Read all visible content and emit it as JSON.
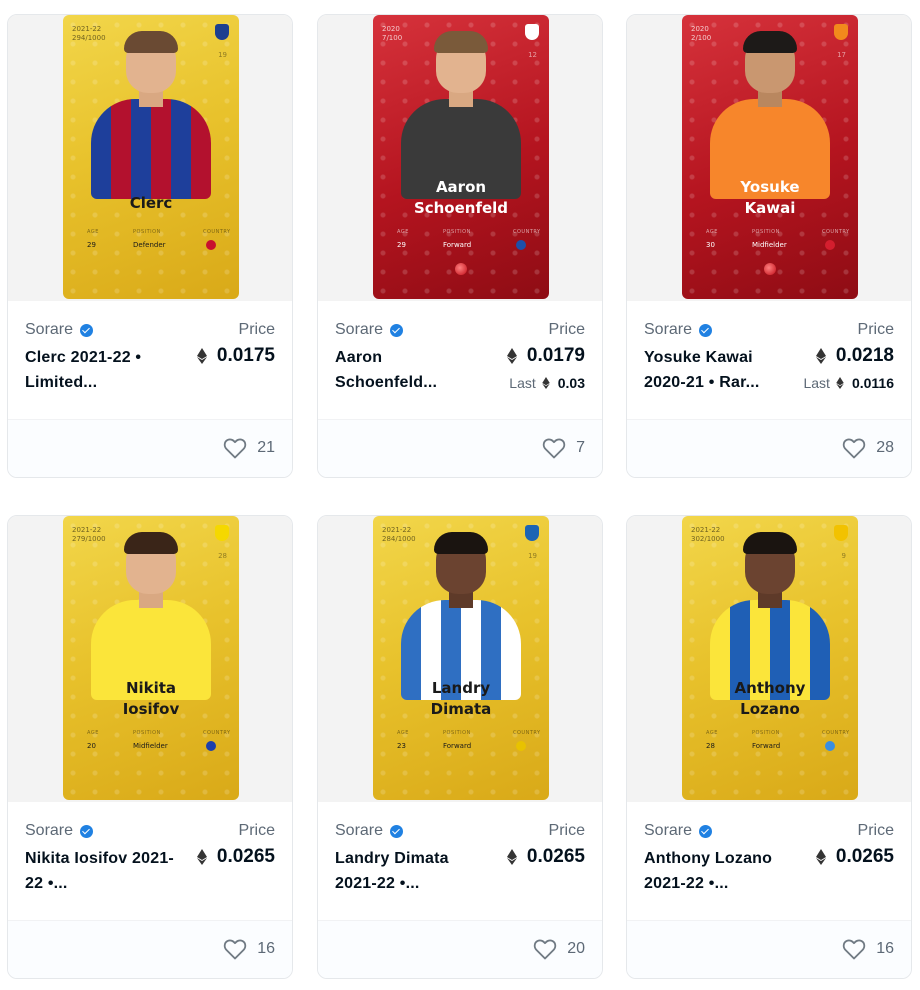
{
  "cards": [
    {
      "card_season": "2021-22",
      "card_serial": "294/1000",
      "card_number": "19",
      "rarity": "limited",
      "card_name": "Clerc",
      "age": "29",
      "position": "Defender",
      "flag_color": "#c8102e",
      "crest_color": "#1d3f8f",
      "kit_primary": "#1e3f9b",
      "kit_secondary": "#b3112e",
      "hair_color": "#6a4a33",
      "stat_labels": {
        "age": "AGE",
        "position": "POSITION",
        "country": "COUNTRY"
      },
      "creator": "Sorare",
      "title": "Clerc 2021-22 • Limited...",
      "price_label": "Price",
      "price": "0.0175",
      "last_label": "",
      "last_price": "",
      "likes": "21"
    },
    {
      "card_season": "2020",
      "card_serial": "7/100",
      "card_number": "12",
      "rarity": "rare",
      "card_name": "Aaron\nSchoenfeld",
      "age": "29",
      "position": "Forward",
      "flag_color": "#1d4fa8",
      "crest_color": "#ffffff",
      "kit_primary": "#3a3a3a",
      "kit_secondary": "#3a3a3a",
      "hair_color": "#7a5a3a",
      "stat_labels": {
        "age": "AGE",
        "position": "POSITION",
        "country": "COUNTRY"
      },
      "creator": "Sorare",
      "title": "Aaron Schoenfeld...",
      "price_label": "Price",
      "price": "0.0179",
      "last_label": "Last",
      "last_price": "0.03",
      "likes": "7"
    },
    {
      "card_season": "2020",
      "card_serial": "2/100",
      "card_number": "17",
      "rarity": "rare",
      "card_name": "Yosuke\nKawai",
      "age": "30",
      "position": "Midfielder",
      "flag_color": "#d41e2e",
      "crest_color": "#f28a1c",
      "kit_primary": "#f7862b",
      "kit_secondary": "#f7862b",
      "hair_color": "#1d1a18",
      "stat_labels": {
        "age": "AGE",
        "position": "POSITION",
        "country": "COUNTRY"
      },
      "creator": "Sorare",
      "title": "Yosuke Kawai 2020-21 • Rar...",
      "price_label": "Price",
      "price": "0.0218",
      "last_label": "Last",
      "last_price": "0.0116",
      "likes": "28"
    },
    {
      "card_season": "2021-22",
      "card_serial": "279/1000",
      "card_number": "28",
      "rarity": "limited",
      "card_name": "Nikita\nIosifov",
      "age": "20",
      "position": "Midfielder",
      "flag_color": "#1c3faa",
      "crest_color": "#f5d800",
      "kit_primary": "#fbe53a",
      "kit_secondary": "#fbe53a",
      "hair_color": "#3a2518",
      "stat_labels": {
        "age": "AGE",
        "position": "POSITION",
        "country": "COUNTRY"
      },
      "creator": "Sorare",
      "title": "Nikita Iosifov 2021-22 •...",
      "price_label": "Price",
      "price": "0.0265",
      "last_label": "",
      "last_price": "",
      "likes": "16"
    },
    {
      "card_season": "2021-22",
      "card_serial": "284/1000",
      "card_number": "19",
      "rarity": "limited",
      "card_name": "Landry\nDimata",
      "age": "23",
      "position": "Forward",
      "flag_color": "#e8c200",
      "crest_color": "#1c64b4",
      "kit_primary": "#2f6fc2",
      "kit_secondary": "#ffffff",
      "hair_color": "#1a1410",
      "stat_labels": {
        "age": "AGE",
        "position": "POSITION",
        "country": "COUNTRY"
      },
      "creator": "Sorare",
      "title": "Landry Dimata 2021-22 •...",
      "price_label": "Price",
      "price": "0.0265",
      "last_label": "",
      "last_price": "",
      "likes": "20"
    },
    {
      "card_season": "2021-22",
      "card_serial": "302/1000",
      "card_number": "9",
      "rarity": "limited",
      "card_name": "Anthony\nLozano",
      "age": "28",
      "position": "Forward",
      "flag_color": "#3a8ee0",
      "crest_color": "#f2c200",
      "kit_primary": "#fbe53a",
      "kit_secondary": "#1f5fb5",
      "hair_color": "#1a1410",
      "stat_labels": {
        "age": "AGE",
        "position": "POSITION",
        "country": "COUNTRY"
      },
      "creator": "Sorare",
      "title": "Anthony Lozano 2021-22 •...",
      "price_label": "Price",
      "price": "0.0265",
      "last_label": "",
      "last_price": "",
      "likes": "16"
    }
  ]
}
